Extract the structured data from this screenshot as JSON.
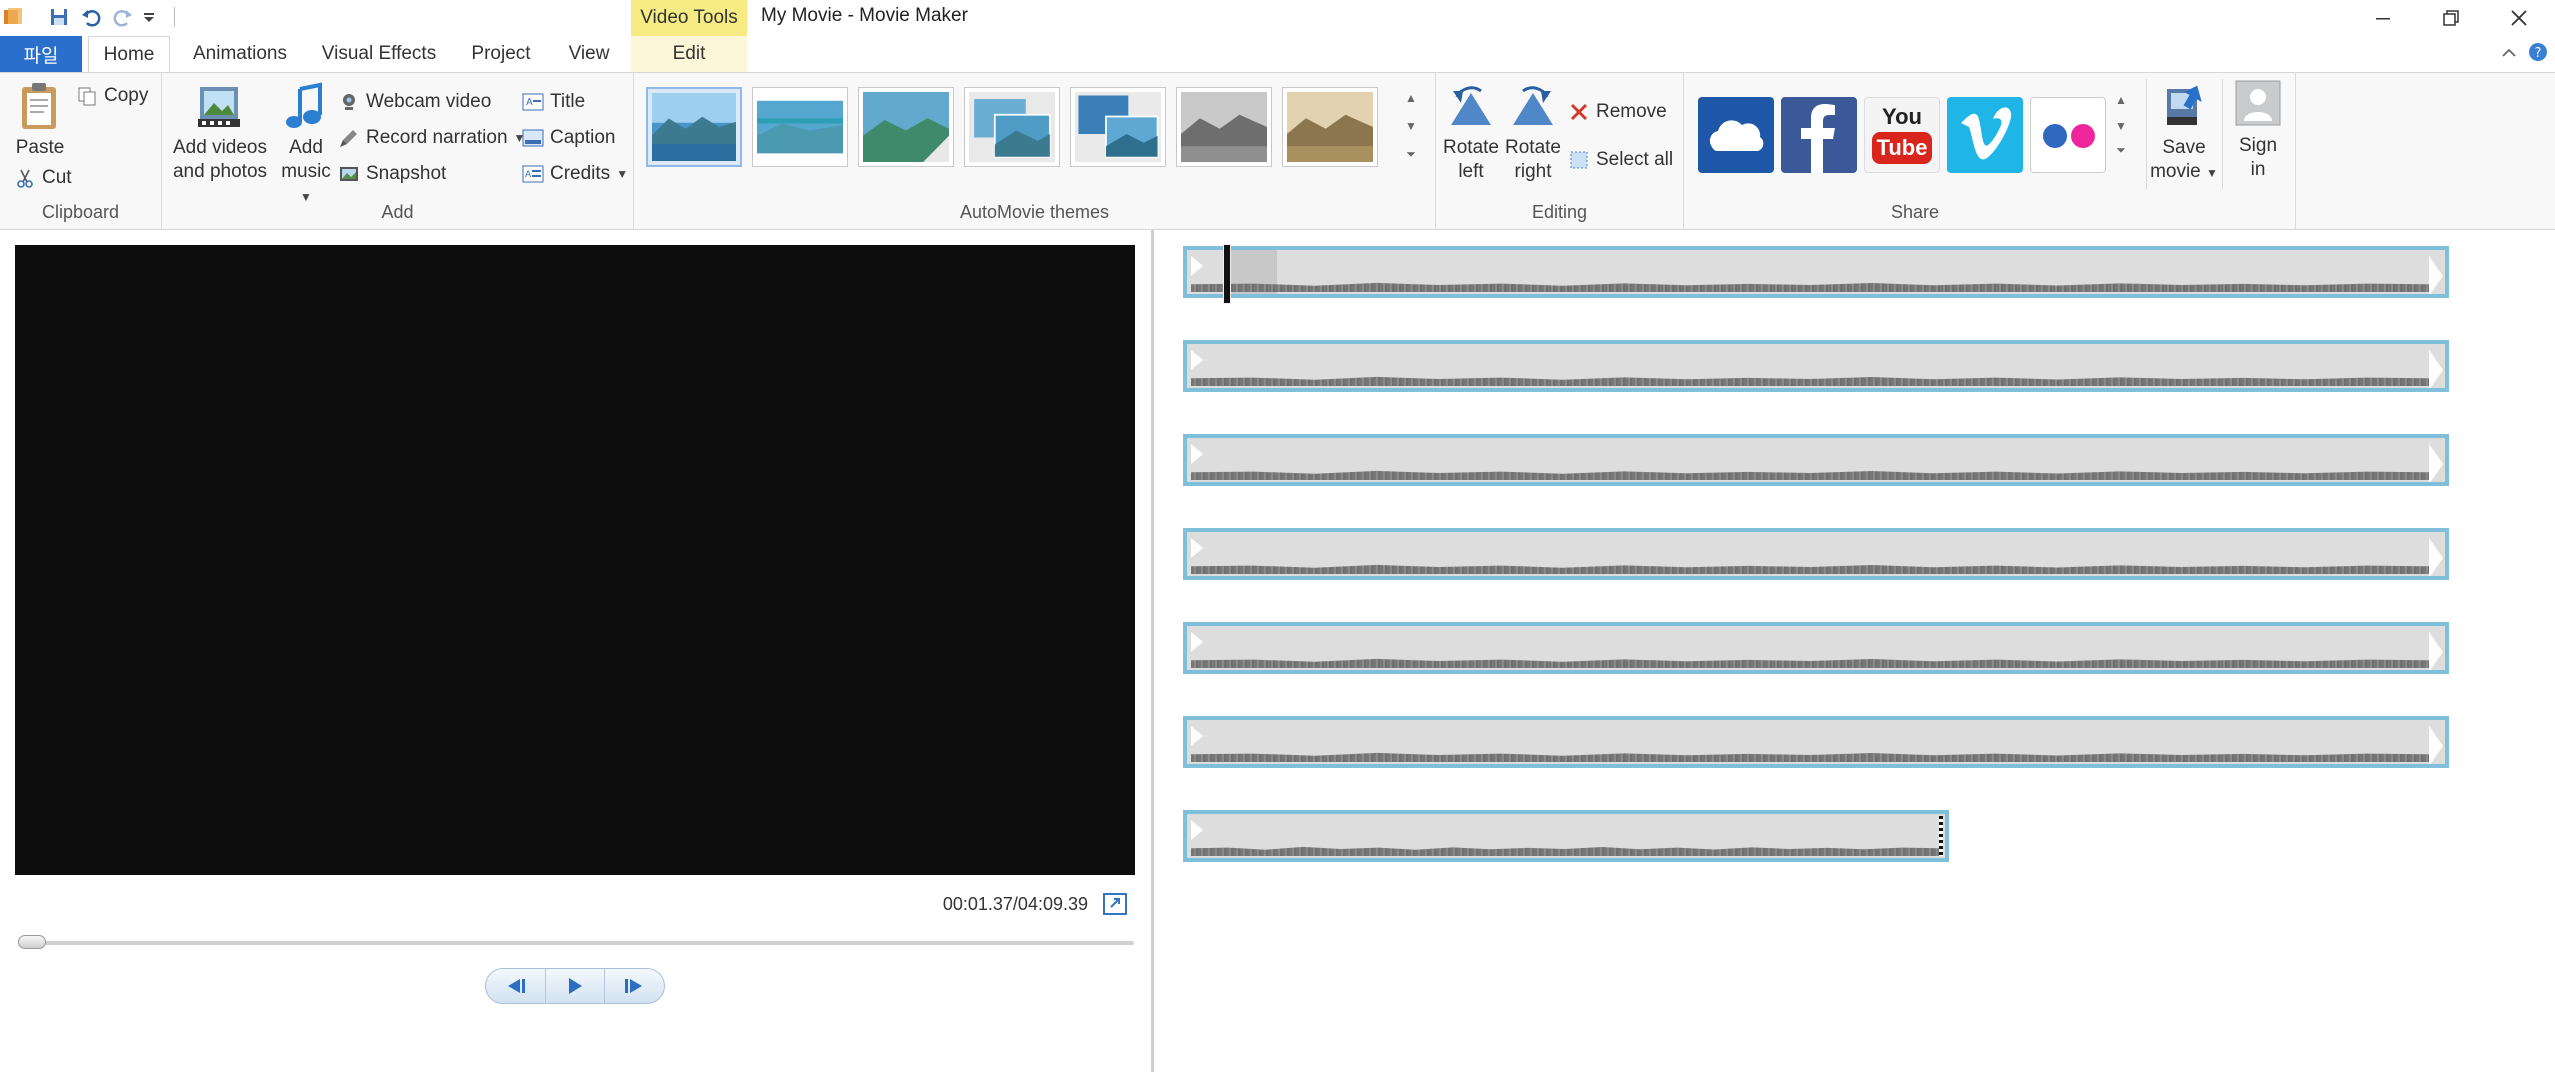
{
  "window": {
    "title": "My Movie - Movie Maker",
    "context_tab_group": "Video Tools"
  },
  "tabs": {
    "file": "파일",
    "home": "Home",
    "animations": "Animations",
    "visual_effects": "Visual Effects",
    "project": "Project",
    "view": "View",
    "edit": "Edit"
  },
  "ribbon": {
    "clipboard": {
      "label": "Clipboard",
      "paste": "Paste",
      "copy": "Copy",
      "cut": "Cut"
    },
    "add": {
      "label": "Add",
      "add_videos_1": "Add videos",
      "add_videos_2": "and photos",
      "add_music_1": "Add",
      "add_music_2": "music",
      "webcam": "Webcam video",
      "narration": "Record narration",
      "snapshot": "Snapshot",
      "title": "Title",
      "caption": "Caption",
      "credits": "Credits"
    },
    "themes": {
      "label": "AutoMovie themes",
      "count": 7,
      "selected_index": 0
    },
    "editing": {
      "label": "Editing",
      "rotate_left_1": "Rotate",
      "rotate_left_2": "left",
      "rotate_right_1": "Rotate",
      "rotate_right_2": "right",
      "remove": "Remove",
      "select_all": "Select all"
    },
    "share": {
      "label": "Share",
      "services": [
        "onedrive-icon",
        "facebook-icon",
        "youtube-icon",
        "vimeo-icon",
        "flickr-icon"
      ],
      "youtube_1": "You",
      "youtube_2": "Tube",
      "save_movie_1": "Save",
      "save_movie_2": "movie",
      "sign_in_1": "Sign",
      "sign_in_2": "in"
    }
  },
  "player": {
    "timecode": "00:01.37/04:09.39"
  },
  "colors": {
    "file_tab": "#2a6fcb",
    "context_tab": "#f7ec84",
    "clip_border": "#7fbfda",
    "preview_bg": "#0d0d0d"
  }
}
